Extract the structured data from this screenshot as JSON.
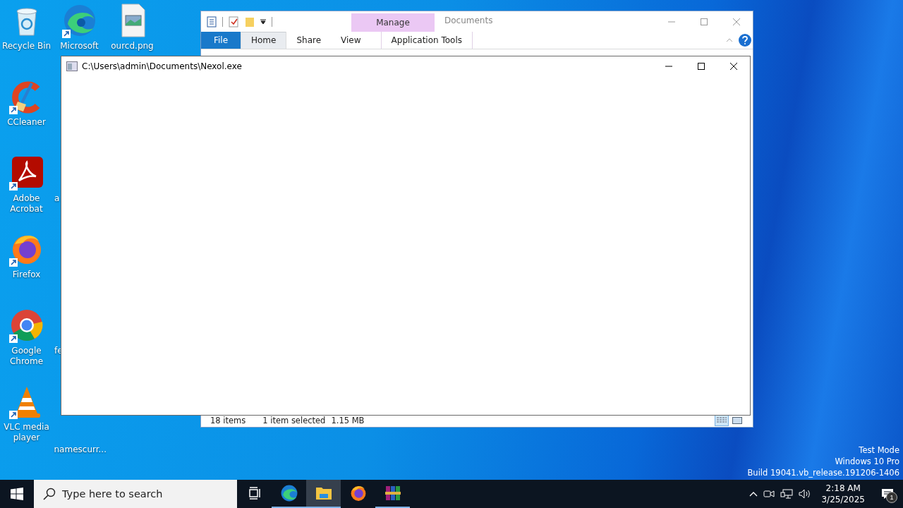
{
  "desktop_icons": [
    {
      "label": "Recycle Bin",
      "kind": "recycle",
      "shortcut": false
    },
    {
      "label": "CCleaner",
      "kind": "ccleaner",
      "shortcut": true
    },
    {
      "label": "Adobe Acrobat",
      "kind": "acrobat",
      "shortcut": true
    },
    {
      "label": "Firefox",
      "kind": "firefox",
      "shortcut": true
    },
    {
      "label": "Google Chrome",
      "kind": "chrome",
      "shortcut": true
    },
    {
      "label": "VLC media player",
      "kind": "vlc",
      "shortcut": true
    },
    {
      "label": "Microsoft",
      "kind": "edge",
      "shortcut": true
    },
    {
      "label": "a",
      "kind": "covered"
    },
    {
      "label": "fe",
      "kind": "covered"
    },
    {
      "label": "namescurr...",
      "kind": "covered"
    },
    {
      "label": "ourcd.png",
      "kind": "image-file",
      "shortcut": false
    }
  ],
  "explorer": {
    "context_tab": "Manage",
    "title": "Documents",
    "tabs": [
      {
        "label": "File",
        "kind": "file",
        "selected": false
      },
      {
        "label": "Home",
        "kind": "tab",
        "selected": true
      },
      {
        "label": "Share",
        "kind": "tab",
        "selected": false
      },
      {
        "label": "View",
        "kind": "tab",
        "selected": false
      },
      {
        "label": "Application Tools",
        "kind": "context",
        "selected": false
      }
    ],
    "status": {
      "items": "18 items",
      "selection": "1 item selected",
      "size": "1.15 MB"
    }
  },
  "console": {
    "title": "C:\\Users\\admin\\Documents\\Nexol.exe"
  },
  "system_info": [
    "Test Mode",
    "Windows 10 Pro",
    "Build 19041.vb_release.191206-1406"
  ],
  "taskbar": {
    "search_placeholder": "Type here to search",
    "apps": [
      {
        "kind": "task-view",
        "running": false,
        "active": false
      },
      {
        "kind": "edge",
        "running": true,
        "active": false
      },
      {
        "kind": "explorer",
        "running": true,
        "active": true
      },
      {
        "kind": "firefox",
        "running": false,
        "active": false
      },
      {
        "kind": "winrar",
        "running": true,
        "active": false
      }
    ],
    "clock": {
      "time": "2:18 AM",
      "date": "3/25/2025"
    },
    "notifications": {
      "count": "1"
    }
  }
}
